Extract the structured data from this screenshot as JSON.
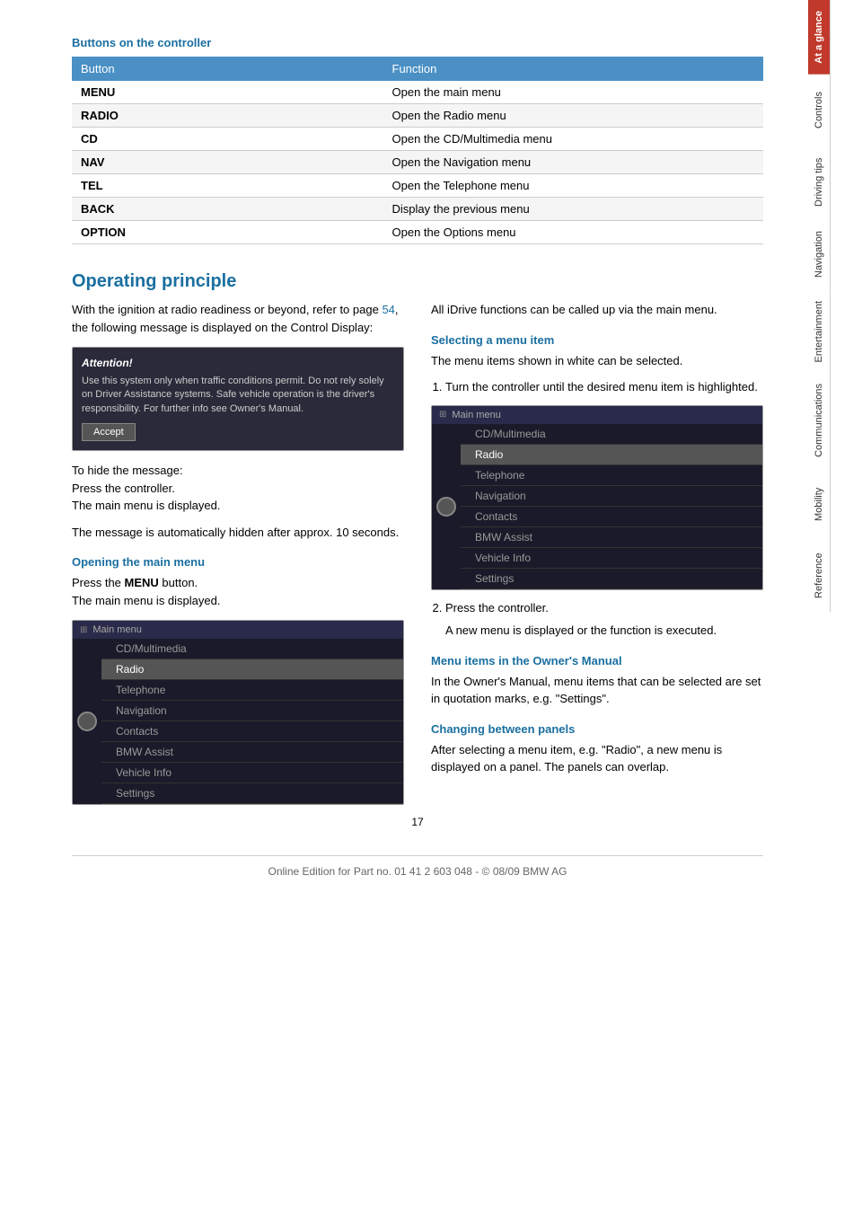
{
  "page": {
    "number": "17",
    "footer": "Online Edition for Part no. 01 41 2 603 048 - © 08/09 BMW AG"
  },
  "sidebar": {
    "tabs": [
      {
        "label": "At a glance",
        "active": true
      },
      {
        "label": "Controls",
        "active": false
      },
      {
        "label": "Driving tips",
        "active": false
      },
      {
        "label": "Navigation",
        "active": false
      },
      {
        "label": "Entertainment",
        "active": false
      },
      {
        "label": "Communications",
        "active": false
      },
      {
        "label": "Mobility",
        "active": false
      },
      {
        "label": "Reference",
        "active": false
      }
    ]
  },
  "buttons_section": {
    "title": "Buttons on the controller",
    "table": {
      "col1_header": "Button",
      "col2_header": "Function",
      "rows": [
        {
          "button": "MENU",
          "function": "Open the main menu"
        },
        {
          "button": "RADIO",
          "function": "Open the Radio menu"
        },
        {
          "button": "CD",
          "function": "Open the CD/Multimedia menu"
        },
        {
          "button": "NAV",
          "function": "Open the Navigation menu"
        },
        {
          "button": "TEL",
          "function": "Open the Telephone menu"
        },
        {
          "button": "BACK",
          "function": "Display the previous menu"
        },
        {
          "button": "OPTION",
          "function": "Open the Options menu"
        }
      ]
    }
  },
  "operating_principle": {
    "title": "Operating principle",
    "intro_text": "With the ignition at radio readiness or beyond, refer to page ",
    "intro_link": "54",
    "intro_text2": ", the following message is displayed on the Control Display:",
    "attention_box": {
      "header": "Attention!",
      "text": "Use this system only when traffic conditions permit. Do not rely solely on Driver Assistance systems. Safe vehicle operation is the driver's responsibility. For further info see Owner's Manual.",
      "button": "Accept"
    },
    "hide_message_text": "To hide the message:\nPress the controller.\nThe main menu is displayed.",
    "auto_hide_text": "The message is automatically hidden after approx. 10 seconds.",
    "opening_main_menu": {
      "subtitle": "Opening the main menu",
      "text1": "Press the ",
      "bold": "MENU",
      "text2": " button.",
      "text3": "The main menu is displayed."
    },
    "main_menu_items": [
      {
        "label": "CD/Multimedia",
        "highlighted": false
      },
      {
        "label": "Radio",
        "highlighted": true
      },
      {
        "label": "Telephone",
        "highlighted": false
      },
      {
        "label": "Navigation",
        "highlighted": false
      },
      {
        "label": "Contacts",
        "highlighted": false
      },
      {
        "label": "BMW Assist",
        "highlighted": false
      },
      {
        "label": "Vehicle Info",
        "highlighted": false
      },
      {
        "label": "Settings",
        "highlighted": false
      }
    ],
    "right_col": {
      "all_functions_text": "All iDrive functions can be called up via the main menu.",
      "selecting_menu_item": {
        "subtitle": "Selecting a menu item",
        "text": "The menu items shown in white can be selected.",
        "steps": [
          "Turn the controller until the desired menu item is highlighted.",
          "Press the controller."
        ],
        "step2_result": "A new menu is displayed or the function is executed."
      },
      "menu_items_owners_manual": {
        "subtitle": "Menu items in the Owner's Manual",
        "text": "In the Owner's Manual, menu items that can be selected are set in quotation marks, e.g. \"Settings\"."
      },
      "changing_between_panels": {
        "subtitle": "Changing between panels",
        "text": "After selecting a menu item, e.g. \"Radio\", a new menu is displayed on a panel. The panels can overlap."
      }
    }
  }
}
